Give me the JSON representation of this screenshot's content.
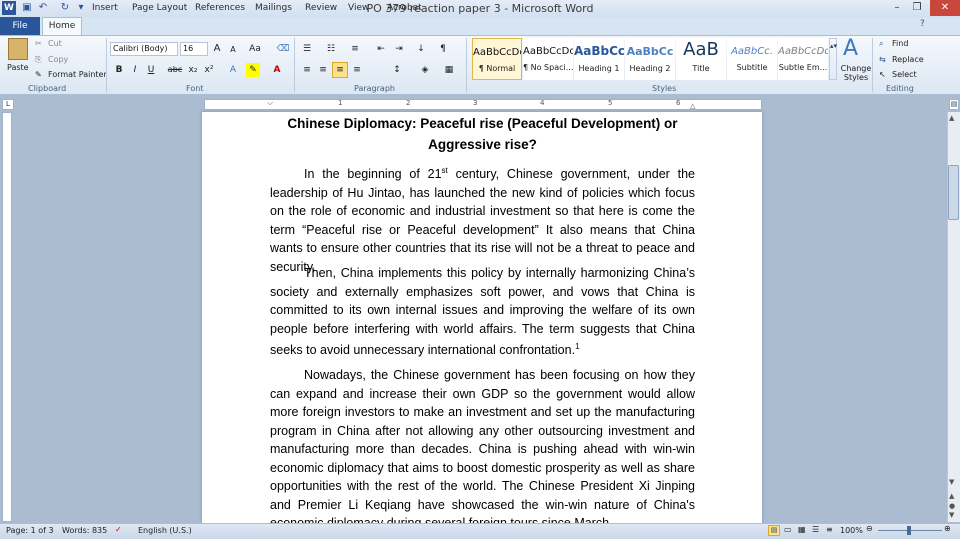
{
  "window": {
    "title": "PO 379 reaction paper 3  -  Microsoft Word"
  },
  "quick_access": [
    "word-icon",
    "save-icon",
    "undo-icon",
    "redo-icon",
    "customize-icon"
  ],
  "tabs": [
    "File",
    "Home",
    "Insert",
    "Page Layout",
    "References",
    "Mailings",
    "Review",
    "View",
    "Acrobat"
  ],
  "ribbon": {
    "clipboard": {
      "paste": "Paste",
      "cut": "Cut",
      "copy": "Copy",
      "format_painter": "Format Painter",
      "label": "Clipboard"
    },
    "font": {
      "name": "Calibri (Body)",
      "size": "16",
      "label": "Font",
      "bold": "B",
      "italic": "I",
      "underline": "U",
      "strike": "abc",
      "subscript": "x₂",
      "superscript": "x²"
    },
    "paragraph": {
      "label": "Paragraph",
      "pilcrow": "¶"
    },
    "styles": {
      "label": "Styles",
      "items": [
        {
          "sample": "AaBbCcDc",
          "name": "¶ Normal"
        },
        {
          "sample": "AaBbCcDc",
          "name": "¶ No Spaci..."
        },
        {
          "sample": "AaBbCc",
          "name": "Heading 1"
        },
        {
          "sample": "AaBbCc",
          "name": "Heading 2"
        },
        {
          "sample": "AaB",
          "name": "Title"
        },
        {
          "sample": "AaBbCc.",
          "name": "Subtitle"
        },
        {
          "sample": "AaBbCcDc",
          "name": "Subtle Em..."
        }
      ],
      "change_styles": "Change Styles"
    },
    "editing": {
      "label": "Editing",
      "find": "Find",
      "replace": "Replace",
      "select": "Select"
    }
  },
  "ruler_numbers": [
    "1",
    "2",
    "3",
    "4",
    "5",
    "6"
  ],
  "document": {
    "title_line1": "Chinese Diplomacy: Peaceful rise (Peaceful Development) or",
    "title_line2": "Aggressive rise?",
    "p1_a": "In the beginning of 21",
    "p1_sup": "st",
    "p1_b": " century, Chinese government, under the leadership of Hu Jintao, has launched the new kind of policies which focus on the role of economic and industrial investment so that here is come the term “Peaceful rise or Peaceful development” It also means that China wants to ensure other countries that its rise will not be a threat to peace and security.",
    "p2": "Then, China implements this policy by internally harmonizing China’s society and externally emphasizes soft power, and vows that China is committed to its own internal issues and improving the welfare of its own people before interfering with world affairs. The term suggests that China seeks to avoid unnecessary international confrontation.",
    "p2_sup": "1",
    "p3": "Nowadays, the Chinese government has been focusing on how they can expand and increase their own GDP so the government would allow more foreign investors to make an investment and set up the manufacturing program in China after not allowing any other outsourcing investment and manufacturing more than decades. China is pushing ahead with win-win economic diplomacy that aims to boost domestic prosperity as well as share opportunities with the rest of the world. The Chinese President Xi Jinping and Premier Li Keqiang have showcased the win-win nature of China's economic diplomacy during several foreign tours since March"
  },
  "status": {
    "page": "Page: 1 of 3",
    "words": "Words: 835",
    "language": "English (U.S.)",
    "zoom": "100%"
  }
}
